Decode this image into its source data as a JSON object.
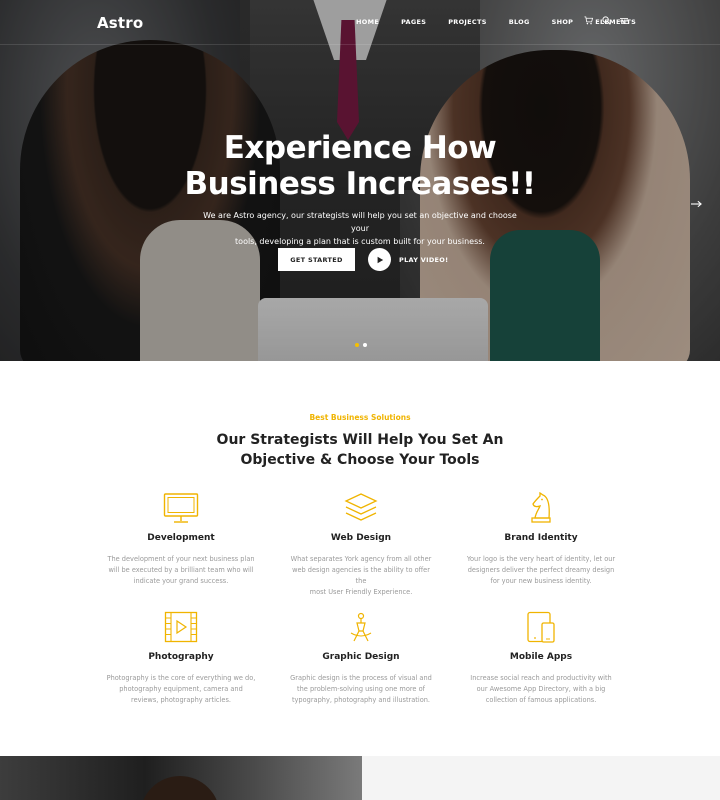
{
  "brand": {
    "logo": "Astro"
  },
  "nav": {
    "items": [
      "HOME",
      "PAGES",
      "PROJECTS",
      "BLOG",
      "SHOP",
      "ELEMENTS"
    ],
    "icons": [
      "cart-icon",
      "search-icon",
      "menu-icon"
    ]
  },
  "hero": {
    "title_line1": "Experience How",
    "title_line2": "Business Increases!!",
    "subtitle_line1": "We are Astro agency, our strategists will help you set an objective and choose your",
    "subtitle_line2": "tools, developing a plan that is custom built for your business.",
    "cta_primary": "GET STARTED",
    "cta_video": "PLAY VIDEO!",
    "slides": 2,
    "active_slide": 1
  },
  "services_section": {
    "eyebrow": "Best Business Solutions",
    "title_line1": "Our Strategists Will Help You Set An",
    "title_line2": "Objective & Choose Your Tools",
    "accent_color": "#f0b400",
    "items": [
      {
        "icon": "monitor-icon",
        "title": "Development",
        "l1": "The development of your next business plan",
        "l2": "will be executed by a brilliant team who will",
        "l3": "indicate your grand success."
      },
      {
        "icon": "layers-icon",
        "title": "Web Design",
        "l1": "What separates York agency from all other",
        "l2": "web design agencies is the ability to offer the",
        "l3": "most User Friendly Experience."
      },
      {
        "icon": "chess-knight-icon",
        "title": "Brand Identity",
        "l1": "Your logo is the very heart of identity, let our",
        "l2": "designers deliver the perfect dreamy design",
        "l3": "for your new business identity."
      },
      {
        "icon": "film-play-icon",
        "title": "Photography",
        "l1": "Photography is the core of everything we do,",
        "l2": "photography equipment, camera and",
        "l3": "reviews, photography articles."
      },
      {
        "icon": "compass-pen-icon",
        "title": "Graphic Design",
        "l1": "Graphic design is the process of visual and",
        "l2": "the problem-solving using one more of",
        "l3": "typography, photography and illustration."
      },
      {
        "icon": "devices-icon",
        "title": "Mobile Apps",
        "l1": "Increase social reach and productivity with",
        "l2": "our Awesome App Directory, with a big",
        "l3": "collection of famous applications."
      }
    ]
  }
}
